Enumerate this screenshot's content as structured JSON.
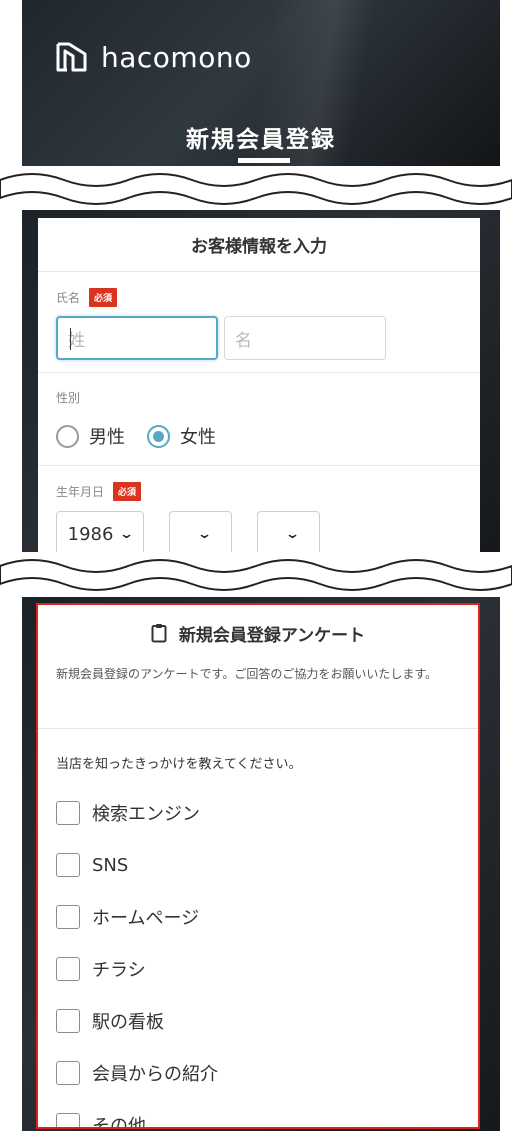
{
  "header": {
    "logo_text": "hacomono",
    "logo_icon": "hacomono-logo-mark",
    "page_title": "新規会員登録"
  },
  "customer_info": {
    "heading": "お客様情報を入力",
    "required_badge": "必須",
    "name": {
      "label": "氏名",
      "last_placeholder": "姓",
      "first_placeholder": "名"
    },
    "gender": {
      "label": "性別",
      "options": [
        "男性",
        "女性"
      ],
      "selected": "女性"
    },
    "birthdate": {
      "label": "生年月日",
      "year": "1986",
      "month": "",
      "day": ""
    }
  },
  "survey": {
    "icon": "clipboard-icon",
    "heading": "新規会員登録アンケート",
    "description": "新規会員登録のアンケートです。ご回答のご協力をお願いいたします。",
    "question": "当店を知ったきっかけを教えてください。",
    "options": [
      "検索エンジン",
      "SNS",
      "ホームページ",
      "チラシ",
      "駅の看板",
      "会員からの紹介",
      "その他"
    ]
  },
  "colors": {
    "accent": "#55a8c8",
    "required": "#d9341f",
    "highlight_border": "#e0201c"
  }
}
